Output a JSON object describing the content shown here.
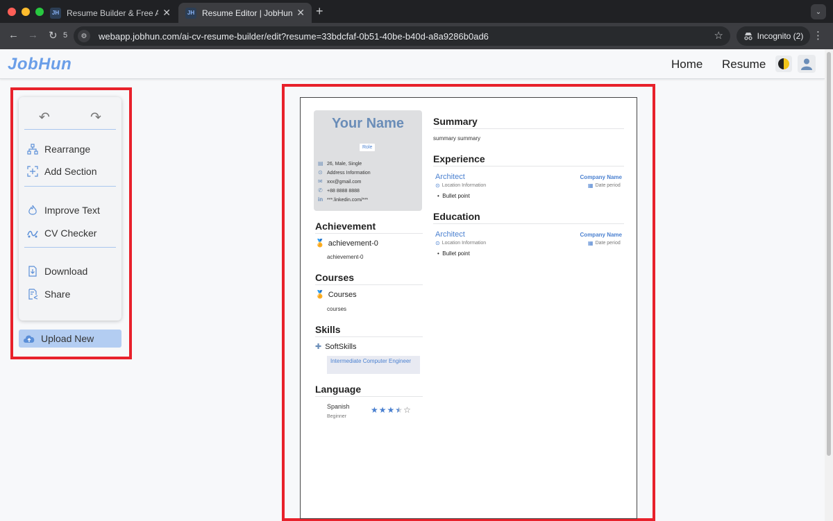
{
  "browser": {
    "tabs": [
      {
        "favicon": "JH",
        "title": "Resume Builder & Free ATS R"
      },
      {
        "favicon": "JH",
        "title": "Resume Editor | JobHun"
      }
    ],
    "reload_count": "5",
    "url": "webapp.jobhun.com/ai-cv-resume-builder/edit?resume=33bdcfaf-0b51-40be-b40d-a8a9286b0ad6",
    "incognito_label": "Incognito (2)"
  },
  "app": {
    "logo": "JobHun",
    "nav": {
      "home": "Home",
      "resume": "Resume"
    }
  },
  "tools": {
    "rearrange": "Rearrange",
    "add_section": "Add Section",
    "improve_text": "Improve Text",
    "cv_checker": "CV Checker",
    "download": "Download",
    "share": "Share",
    "upload_new": "Upload New"
  },
  "resume": {
    "name": "Your Name",
    "role": "Role",
    "personal": {
      "info": "26, Male, Single",
      "address": "Address Information",
      "email": "xxx@gmail.com",
      "phone": "+88 8888 8888",
      "linkedin": "***.linkedin.com/***"
    },
    "achievement": {
      "heading": "Achievement",
      "title": "achievement-0",
      "desc": "achievement-0"
    },
    "courses": {
      "heading": "Courses",
      "title": "Courses",
      "desc": "courses"
    },
    "skills": {
      "heading": "Skills",
      "title": "SoftSkills",
      "tag": "Intermediate Computer Engineer"
    },
    "language": {
      "heading": "Language",
      "name": "Spanish",
      "level": "Beginner",
      "rating": 3.5,
      "max_rating": 5
    },
    "summary": {
      "heading": "Summary",
      "text": "summary summary"
    },
    "experience": {
      "heading": "Experience",
      "title": "Architect",
      "company": "Company Name",
      "location": "Location Information",
      "period": "Date period",
      "bullet": "Bullet point"
    },
    "education": {
      "heading": "Education",
      "title": "Architect",
      "company": "Company Name",
      "location": "Location Information",
      "period": "Date period",
      "bullet": "Bullet point"
    }
  },
  "colors": {
    "accent": "#4a80d0",
    "highlight_border": "#e8212b",
    "logo": "#6a9ee8"
  }
}
